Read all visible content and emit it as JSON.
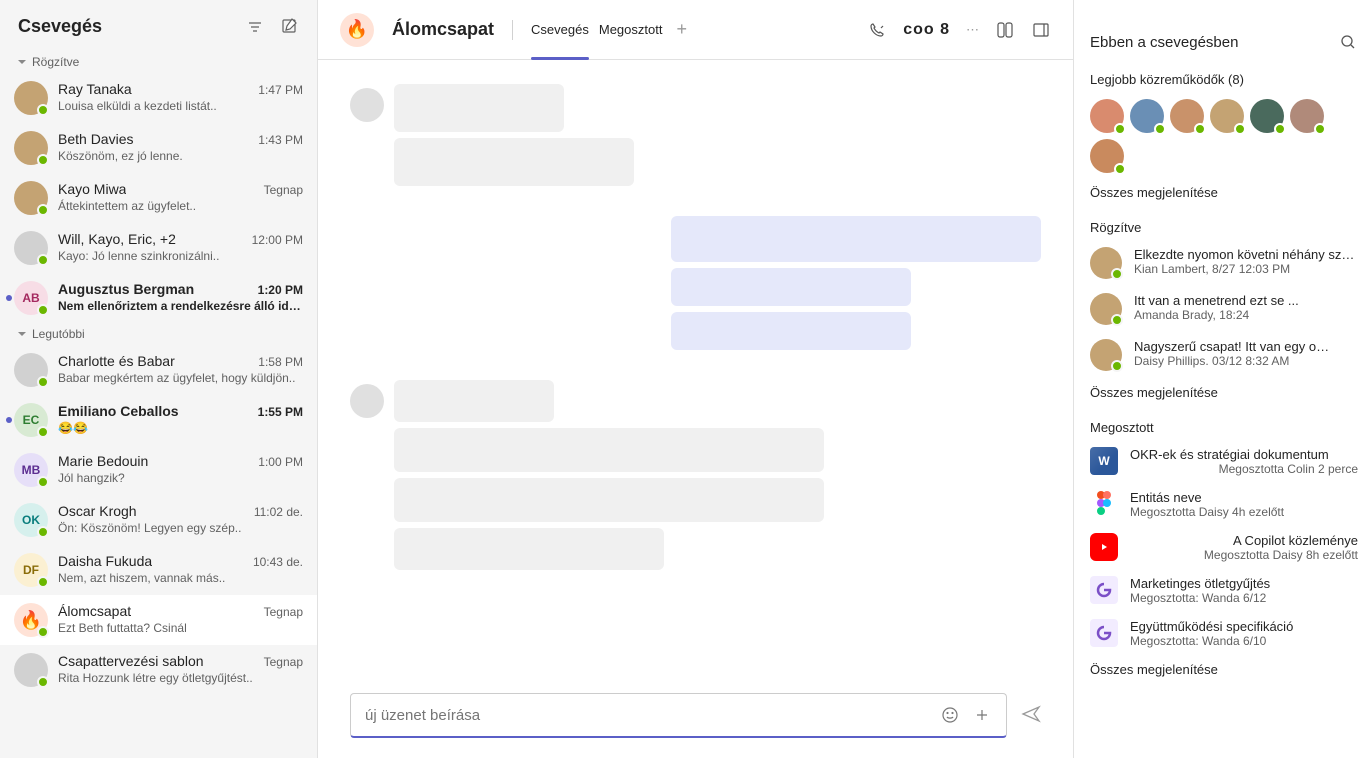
{
  "sidebar": {
    "title": "Csevegés",
    "sections": {
      "pinned": "Rögzítve",
      "recent": "Legutóbbi"
    },
    "pinned_items": [
      {
        "name": "Ray Tanaka",
        "preview": "Louisa elküldi a kezdeti listát..",
        "time": "1:47 PM",
        "initials": "",
        "unread": false
      },
      {
        "name": "Beth  Davies",
        "preview": "Köszönöm, ez jó lenne.",
        "time": "1:43 PM",
        "initials": "",
        "unread": false
      },
      {
        "name": "Kayo Miwa",
        "preview": "Áttekintettem az ügyfelet..",
        "time": "Tegnap",
        "initials": "",
        "unread": false
      },
      {
        "name": "Will, Kayo, Eric, +2",
        "preview": "Kayo: Jó lenne szinkronizálni..",
        "time": "12:00 PM",
        "initials": "",
        "unread": false,
        "group": true
      },
      {
        "name": "Augusztus Bergman",
        "preview": "Nem ellenőriztem a rendelkezésre álló időt..",
        "time": "1:20 PM",
        "initials": "AB",
        "unread": true,
        "color": "pink"
      }
    ],
    "recent_items": [
      {
        "name": "Charlotte és     Babar",
        "preview": "Babar megkértem az ügyfelet, hogy küldjön..",
        "time": "1:58 PM",
        "initials": "",
        "unread": false,
        "group": true
      },
      {
        "name": "Emiliano Ceballos",
        "preview": "😂😂",
        "time": "1:55 PM",
        "initials": "EC",
        "unread": true,
        "color": "green"
      },
      {
        "name": "Marie Bedouin",
        "preview": "Jól hangzik?",
        "time": "1:00 PM",
        "initials": "MB",
        "unread": false,
        "color": "purple"
      },
      {
        "name": "Oscar Krogh",
        "preview": "Ön: Köszönöm! Legyen egy szép..",
        "time": "11:02 de.",
        "initials": "OK",
        "unread": false,
        "color": "teal"
      },
      {
        "name": "Daisha Fukuda",
        "preview": "Nem, azt hiszem, vannak más..",
        "time": "10:43 de.",
        "initials": "DF",
        "unread": false,
        "color": "yellow"
      },
      {
        "name": "Álomcsapat",
        "preview": "Ezt Beth futtatta? Csinál",
        "time": "Tegnap",
        "initials": "🔥",
        "unread": false,
        "active": true,
        "fire": true
      },
      {
        "name": "Csapattervezési sablon",
        "preview": "Rita Hozzunk létre egy ötletgyűjtést..",
        "time": "Tegnap",
        "initials": "",
        "unread": false,
        "group": true
      }
    ]
  },
  "header": {
    "title": "Álomcsapat",
    "tabs": {
      "chat": "Csevegés",
      "shared": "Megosztott"
    },
    "participants": "coo 8"
  },
  "compose": {
    "placeholder": "új üzenet beírása"
  },
  "right_panel": {
    "title": "Ebben a csevegésben",
    "contributors_label": "Legjobb közreműködők (8)",
    "show_all": "Összes megjelenítése",
    "pinned_label": "Rögzítve",
    "pinned": [
      {
        "title": "Elkezdte nyomon követni néhány számot ...",
        "sub": "Kian Lambert, 8/27 12:03 PM"
      },
      {
        "title": "Itt van a menetrend ezt se ...",
        "sub": "Amanda Brady, 18:24"
      },
      {
        "title": "Nagyszerű csapat!    Itt van egy o…",
        "sub": "Daisy Phillips. 03/12 8:32 AM"
      }
    ],
    "shared_label": "Megosztott",
    "shared": [
      {
        "icon": "word",
        "title": "OKR-ek és stratégiai dokumentum",
        "sub": "Megosztotta Colin 2 perce"
      },
      {
        "icon": "figma",
        "title": "Entitás neve",
        "sub": "Megosztotta Daisy 4h ezelőtt"
      },
      {
        "icon": "youtube",
        "title": "A Copilot közleménye",
        "sub": "Megosztotta Daisy 8h ezelőtt"
      },
      {
        "icon": "loop",
        "title": "Marketinges ötletgyűjtés",
        "sub": "Megosztotta: Wanda 6/12"
      },
      {
        "icon": "loop",
        "title": "Együttműködési specifikáció",
        "sub": "Megosztotta: Wanda 6/10"
      }
    ]
  }
}
